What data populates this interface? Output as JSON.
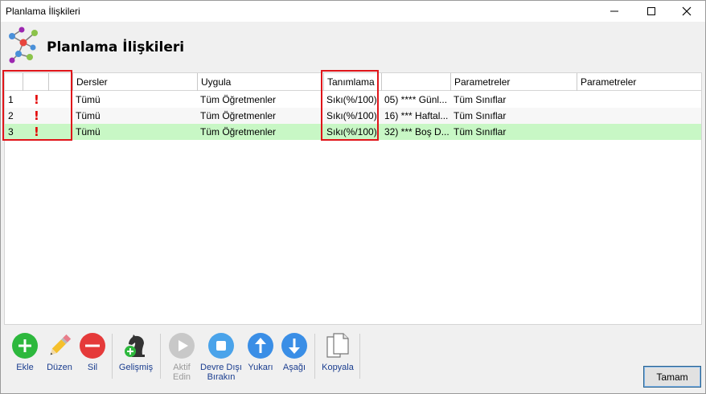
{
  "window": {
    "title": "Planlama İlişkileri",
    "heading": "Planlama İlişkileri"
  },
  "grid": {
    "columns": [
      "Dersler",
      "Uygula",
      "Tanımlama",
      "Parametreler",
      "Parametreler"
    ],
    "rows": [
      {
        "num": "1",
        "flag": "!",
        "dersler": "Tümü",
        "uygula": "Tüm Öğretmenler",
        "tanimlama": "Sıkı(%/100)",
        "kural": "05) **** Günl...",
        "parametreler": "Tüm Sınıflar",
        "parametreler2": ""
      },
      {
        "num": "2",
        "flag": "!",
        "dersler": "Tümü",
        "uygula": "Tüm Öğretmenler",
        "tanimlama": "Sıkı(%/100)",
        "kural": "16) *** Haftal...",
        "parametreler": "Tüm Sınıflar",
        "parametreler2": ""
      },
      {
        "num": "3",
        "flag": "!",
        "dersler": "Tümü",
        "uygula": "Tüm Öğretmenler",
        "tanimlama": "Sıkı(%/100)",
        "kural": "32) *** Boş D...",
        "parametreler": "Tüm Sınıflar",
        "parametreler2": ""
      }
    ],
    "selected_row": 2
  },
  "toolbar": {
    "ekle": "Ekle",
    "duzen": "Düzen",
    "sil": "Sil",
    "gelismis": "Gelişmiş",
    "aktif_1": "Aktif",
    "aktif_2": "Edin",
    "devre_1": "Devre Dışı",
    "devre_2": "Bırakın",
    "yukari": "Yukarı",
    "asagi": "Aşağı",
    "kopyala": "Kopyala"
  },
  "footer": {
    "ok": "Tamam"
  },
  "colors": {
    "selected_row": "#c8f7c5",
    "highlight_box": "#e0151a",
    "add_green": "#2db83d",
    "delete_red": "#e53a3a",
    "arrow_blue": "#3a8ee6"
  },
  "icons": {
    "app": "network-nodes-icon",
    "add": "plus-circle-icon",
    "edit": "pencil-icon",
    "delete": "minus-circle-icon",
    "advanced": "chess-knight-plus-icon",
    "activate": "play-circle-icon",
    "deactivate": "stop-circle-icon",
    "up": "arrow-up-circle-icon",
    "down": "arrow-down-circle-icon",
    "copy": "copy-pages-icon"
  }
}
